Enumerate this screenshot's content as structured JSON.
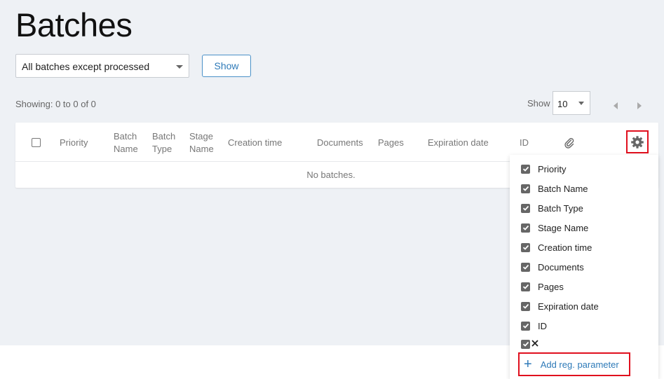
{
  "page_title": "Batches",
  "filter": {
    "selected": "All batches except processed"
  },
  "show_button": "Show",
  "showing_text": "Showing: 0 to 0 of 0",
  "page_size": {
    "label": "Show",
    "value": "10"
  },
  "columns": {
    "priority": "Priority",
    "batch_name": [
      "Batch",
      "Name"
    ],
    "batch_type": [
      "Batch",
      "Type"
    ],
    "stage_name": [
      "Stage",
      "Name"
    ],
    "creation_time": "Creation time",
    "documents": "Documents",
    "pages": "Pages",
    "expiration_date": "Expiration date",
    "id": "ID"
  },
  "empty_text": "No batches.",
  "column_menu": {
    "items": [
      "Priority",
      "Batch Name",
      "Batch Type",
      "Stage Name",
      "Creation time",
      "Documents",
      "Pages",
      "Expiration date",
      "ID"
    ],
    "add_label": "Add reg. parameter"
  },
  "colors": {
    "accent": "#2e7ab8",
    "highlight": "#e0101e",
    "background": "#eef1f5"
  },
  "icons": [
    "paperclip-icon",
    "gear-icon",
    "chevron-left-icon",
    "chevron-right-icon",
    "checkbox-icon",
    "close-icon",
    "plus-icon"
  ]
}
